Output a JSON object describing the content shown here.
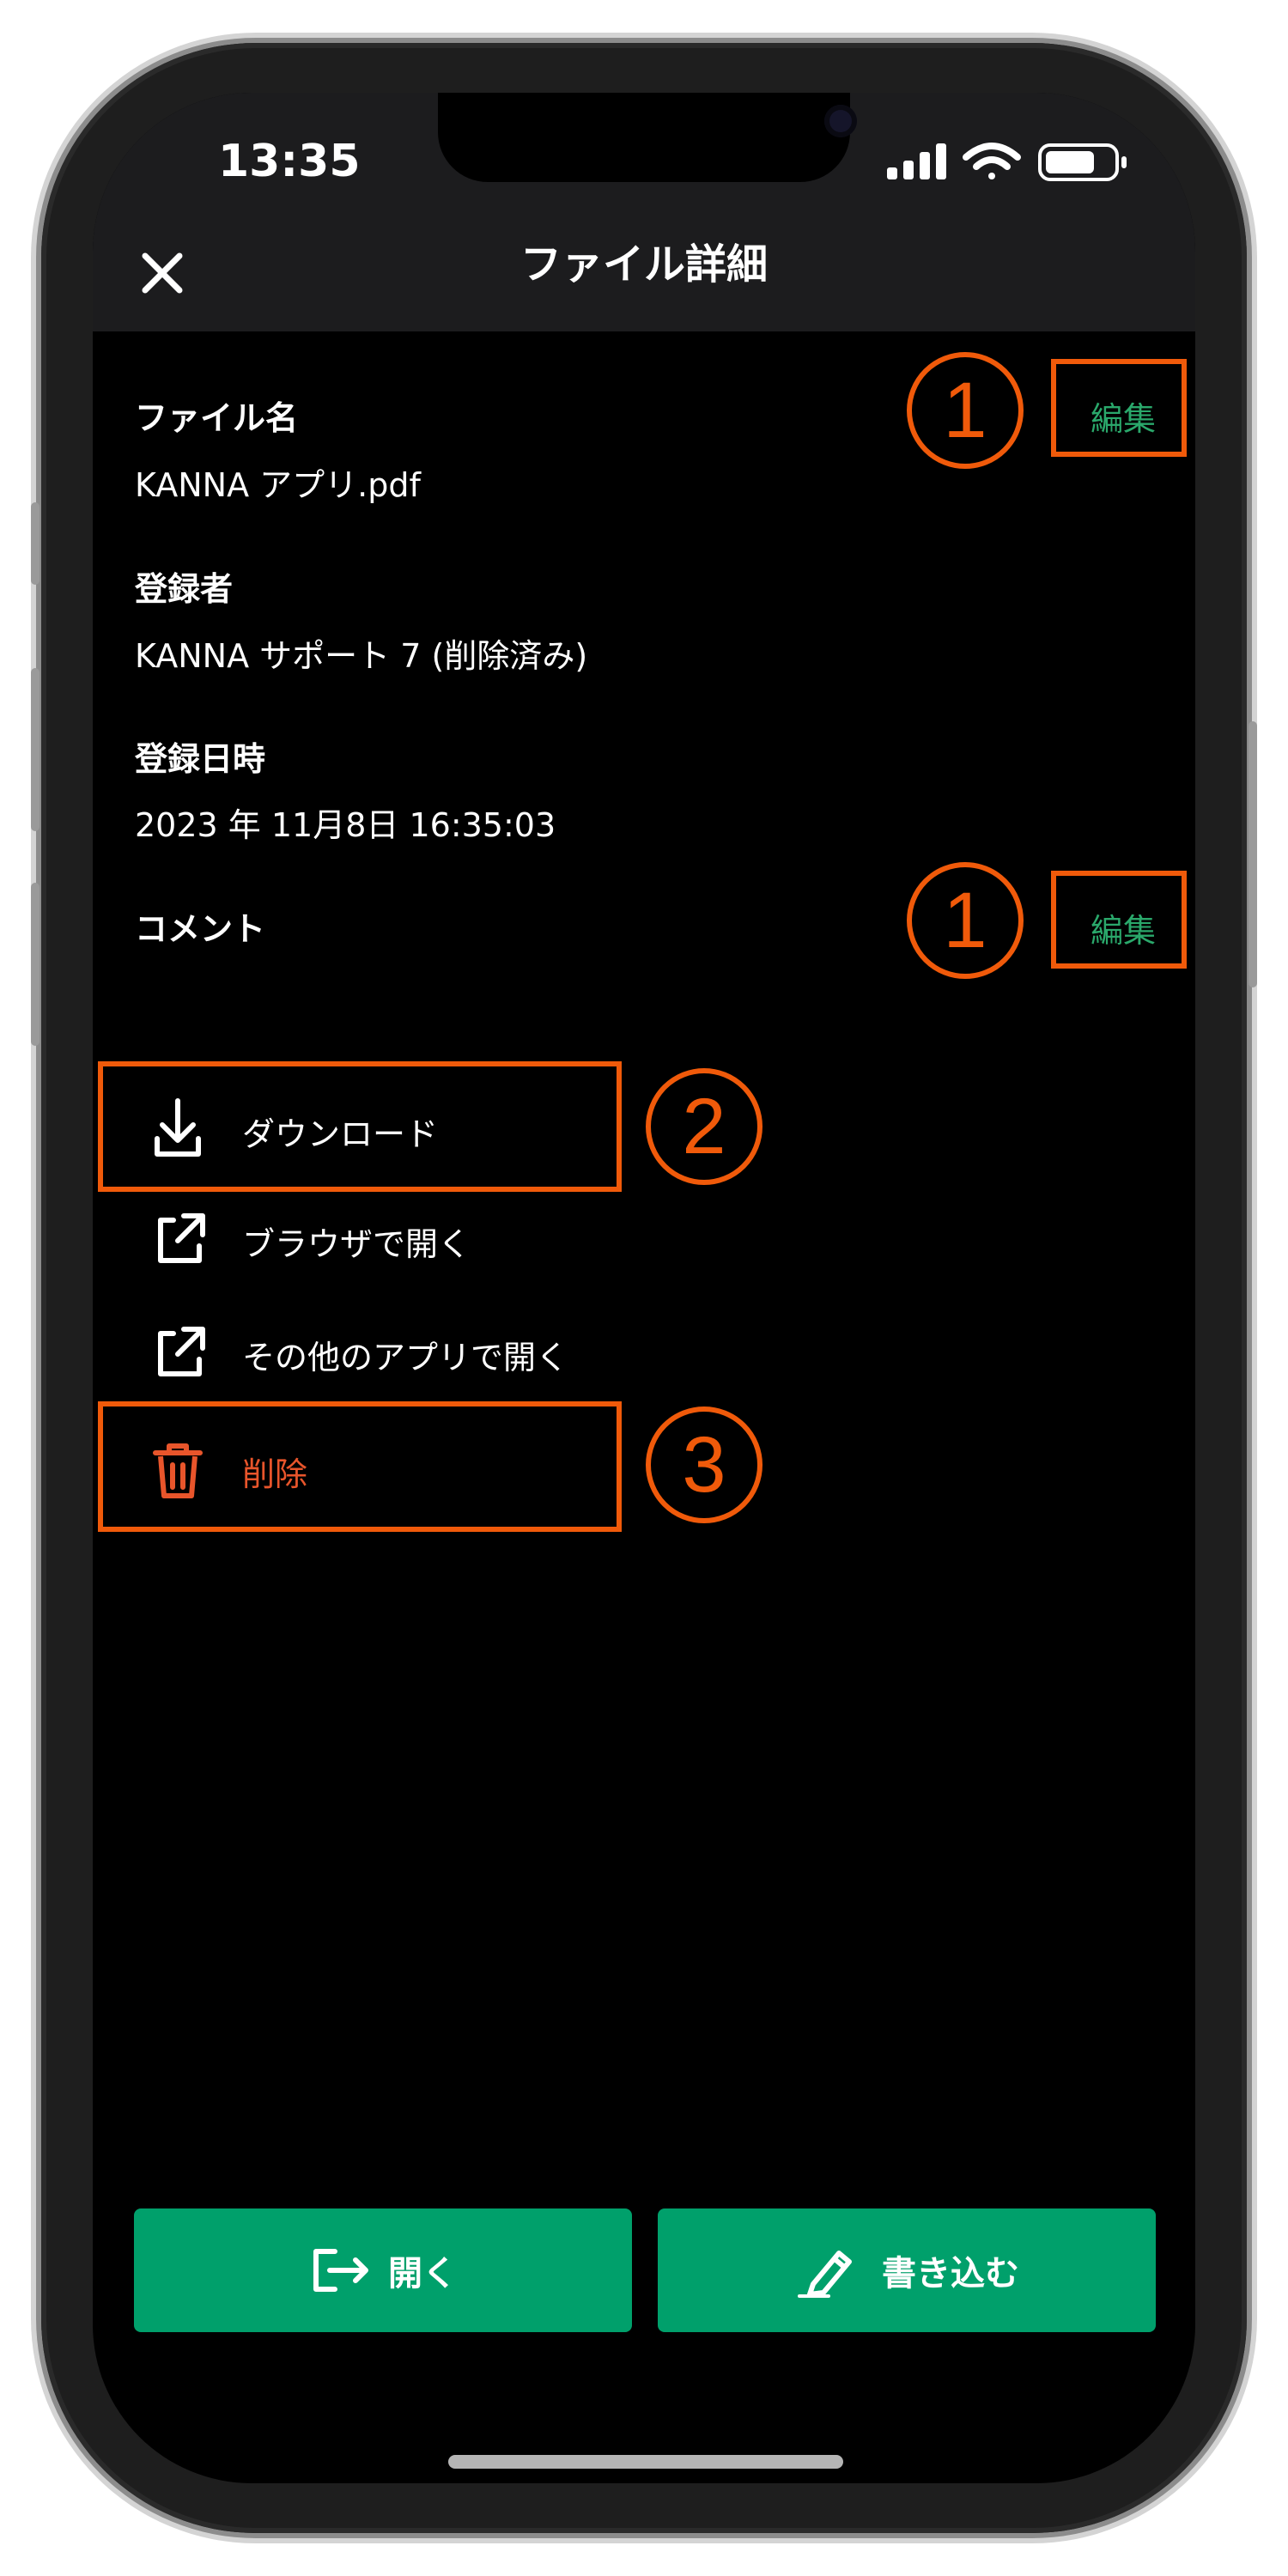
{
  "status_bar": {
    "time": "13:35"
  },
  "header": {
    "title": "ファイル詳細"
  },
  "fields": {
    "file_name": {
      "label": "ファイル名",
      "value": "KANNA アプリ.pdf",
      "edit_label": "編集"
    },
    "registrant": {
      "label": "登録者",
      "value": "KANNA サポート 7 (削除済み)"
    },
    "registered_at": {
      "label": "登録日時",
      "value": "2023 年 11月8日 16:35:03"
    },
    "comment": {
      "label": "コメント",
      "edit_label": "編集"
    }
  },
  "menu": {
    "download": "ダウンロード",
    "open_browser": "ブラウザで開く",
    "open_other": "その他のアプリで開く",
    "delete": "削除"
  },
  "actions": {
    "open": "開く",
    "write": "書き込む"
  },
  "annotations": {
    "n1": "1",
    "n2": "2",
    "n3": "3"
  },
  "colors": {
    "accent": "#00a06b",
    "danger": "#e8552b",
    "annotation": "#f05a0a"
  },
  "icons": [
    "close-icon",
    "download-icon",
    "external-link-icon",
    "trash-icon",
    "open-icon",
    "pen-icon"
  ]
}
